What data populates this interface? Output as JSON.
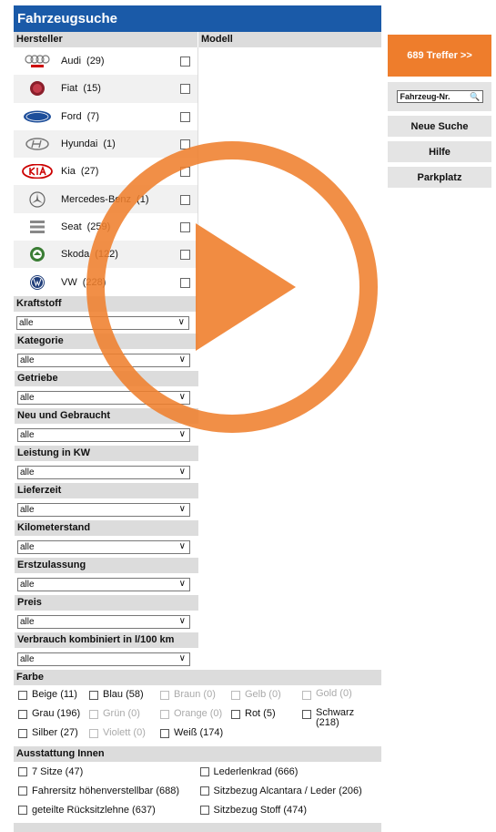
{
  "title": "Fahrzeugsuche",
  "manufacturers_header": "Hersteller",
  "model_header": "Modell",
  "manufacturers": [
    {
      "label": "Audi",
      "count": "(29)",
      "logo": "audi-rings-logo"
    },
    {
      "label": "Fiat",
      "count": "(15)",
      "logo": "fiat-logo"
    },
    {
      "label": "Ford",
      "count": "(7)",
      "logo": "ford-oval-logo"
    },
    {
      "label": "Hyundai",
      "count": "(1)",
      "logo": "hyundai-logo"
    },
    {
      "label": "Kia",
      "count": "(27)",
      "logo": "kia-logo"
    },
    {
      "label": "Mercedes-Benz",
      "count": "(1)",
      "logo": "mercedes-star-logo"
    },
    {
      "label": "Seat",
      "count": "(259)",
      "logo": "seat-logo"
    },
    {
      "label": "Skoda",
      "count": "(122)",
      "logo": "skoda-logo"
    },
    {
      "label": "VW",
      "count": "(228)",
      "logo": "vw-logo"
    }
  ],
  "filters": [
    {
      "label": "Kraftstoff",
      "value": "alle"
    },
    {
      "label": "Kategorie",
      "value": "alle"
    },
    {
      "label": "Getriebe",
      "value": "alle"
    },
    {
      "label": "Neu und Gebraucht",
      "value": "alle"
    },
    {
      "label": "Leistung in KW",
      "value": "alle"
    },
    {
      "label": "Lieferzeit",
      "value": "alle"
    },
    {
      "label": "Kilometerstand",
      "value": "alle"
    },
    {
      "label": "Erstzulassung",
      "value": "alle"
    },
    {
      "label": "Preis",
      "value": "alle"
    },
    {
      "label": "Verbrauch kombiniert in l/100 km",
      "value": "alle"
    }
  ],
  "color_header": "Farbe",
  "colors": [
    [
      {
        "label": "Beige (11)",
        "disabled": false
      },
      {
        "label": "Blau (58)",
        "disabled": false
      },
      {
        "label": "Braun (0)",
        "disabled": true
      },
      {
        "label": "Gelb (0)",
        "disabled": true
      },
      {
        "label": "Gold (0)",
        "disabled": true
      }
    ],
    [
      {
        "label": "Grau (196)",
        "disabled": false
      },
      {
        "label": "Grün (0)",
        "disabled": true
      },
      {
        "label": "Orange (0)",
        "disabled": true
      },
      {
        "label": "Rot (5)",
        "disabled": false
      },
      {
        "label": "Schwarz (218)",
        "disabled": false
      }
    ],
    [
      {
        "label": "Silber (27)",
        "disabled": false
      },
      {
        "label": "Violett (0)",
        "disabled": true
      },
      {
        "label": "Weiß (174)",
        "disabled": false
      }
    ]
  ],
  "interior_header": "Ausstattung Innen",
  "interior": [
    [
      "7 Sitze (47)",
      "Lederlenkrad (666)"
    ],
    [
      "Fahrersitz höhenverstellbar (688)",
      "Sitzbezug Alcantara / Leder (206)"
    ],
    [
      "geteilte Rücksitzlehne (637)",
      "Sitzbezug Stoff (474)"
    ]
  ],
  "results_button": "689 Treffer >>",
  "search_placeholder": "Fahrzeug-Nr.",
  "buttons": [
    "Neue Suche",
    "Hilfe",
    "Parkplatz"
  ],
  "colors_theme": {
    "header_blue": "#1a5aa8",
    "accent_orange": "#ee7d2c",
    "overlay_orange": "#ef7f2d"
  },
  "icons": {
    "search": "magnifier-icon",
    "overlay": "play-button-icon",
    "select": "chevron-down-icon"
  }
}
